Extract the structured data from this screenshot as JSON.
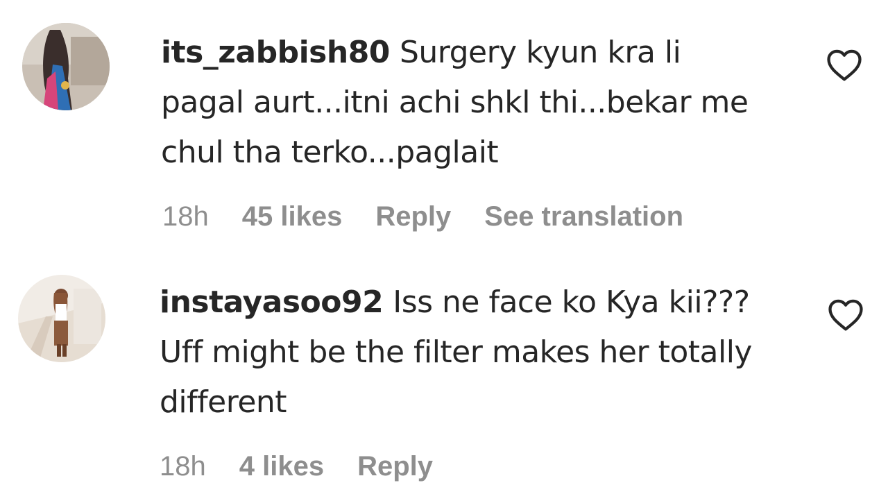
{
  "comments": [
    {
      "username": "its_zabbish80",
      "text": "Surgery kyun kra li pagal aurt...itni achi shkl thi...bekar me chul tha terko...paglait",
      "time": "18h",
      "likes": "45 likes",
      "reply": "Reply",
      "translation": "See translation",
      "like_icon": "heart-outline-icon"
    },
    {
      "username": "instayasoo92",
      "text": "Iss ne face ko Kya kii??? Uff might be the filter makes her totally different",
      "time": "18h",
      "likes": "4 likes",
      "reply": "Reply",
      "like_icon": "heart-outline-icon"
    }
  ]
}
